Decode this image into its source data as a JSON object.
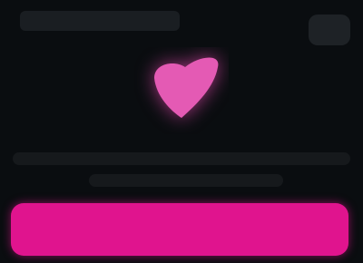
{
  "header": {
    "title": "",
    "menu_icon": "menu-icon"
  },
  "hero": {
    "icon": "heart-shape-icon",
    "color": "#e45ab4"
  },
  "body_text": {
    "line1": "",
    "line2": ""
  },
  "cta": {
    "label": "",
    "color": "#e0148e"
  },
  "theme": {
    "background": "#0a0d10"
  }
}
